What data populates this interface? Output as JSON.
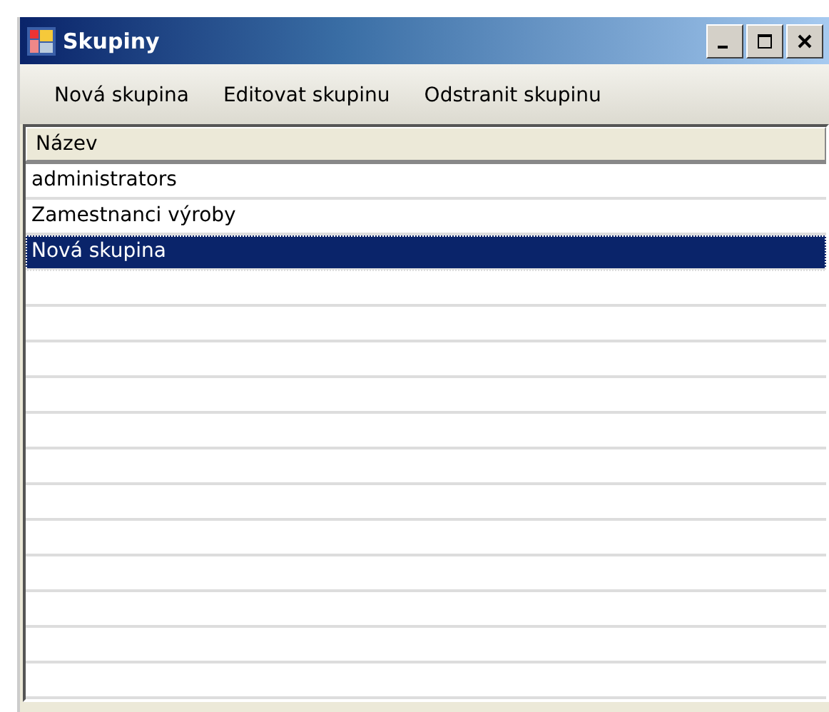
{
  "window": {
    "title": "Skupiny"
  },
  "toolbar": [
    "Nová skupina",
    "Editovat skupinu",
    "Odstranit skupinu"
  ],
  "list": {
    "columns": [
      "Název"
    ],
    "rows": [
      {
        "name": "administrators",
        "selected": false
      },
      {
        "name": "Zamestnanci výroby",
        "selected": false
      },
      {
        "name": "Nová skupina",
        "selected": true
      }
    ]
  }
}
